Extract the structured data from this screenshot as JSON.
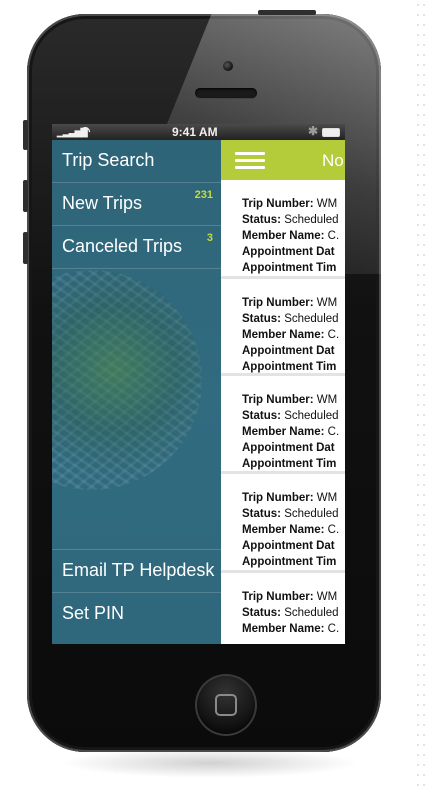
{
  "statusbar": {
    "signal": "▁▂▃▅▇",
    "wifi": "◠",
    "time": "9:41 AM",
    "bluetooth": "✱"
  },
  "sidebar": {
    "items": [
      {
        "label": "Trip Search",
        "badge": ""
      },
      {
        "label": "New Trips",
        "badge": "231"
      },
      {
        "label": "Canceled Trips",
        "badge": "3"
      }
    ],
    "bottom_items": [
      {
        "label": "Email TP Helpdesk"
      },
      {
        "label": "Set PIN"
      }
    ]
  },
  "main": {
    "title": "No",
    "trips": [
      {
        "trip_number_label": "Trip Number:",
        "trip_number": "WM",
        "status_label": "Status:",
        "status": "Scheduled",
        "member_label": "Member Name:",
        "member": "C.",
        "appt_date_label": "Appointment Dat",
        "appt_time_label": "Appointment Tim"
      },
      {
        "trip_number_label": "Trip Number:",
        "trip_number": "WM",
        "status_label": "Status:",
        "status": "Scheduled",
        "member_label": "Member Name:",
        "member": "C.",
        "appt_date_label": "Appointment Dat",
        "appt_time_label": "Appointment Tim"
      },
      {
        "trip_number_label": "Trip Number:",
        "trip_number": "WM",
        "status_label": "Status:",
        "status": "Scheduled",
        "member_label": "Member Name:",
        "member": "C.",
        "appt_date_label": "Appointment Dat",
        "appt_time_label": "Appointment Tim"
      },
      {
        "trip_number_label": "Trip Number:",
        "trip_number": "WM",
        "status_label": "Status:",
        "status": "Scheduled",
        "member_label": "Member Name:",
        "member": "C.",
        "appt_date_label": "Appointment Dat",
        "appt_time_label": "Appointment Tim"
      },
      {
        "trip_number_label": "Trip Number:",
        "trip_number": "WM",
        "status_label": "Status:",
        "status": "Scheduled",
        "member_label": "Member Name:",
        "member": "C.",
        "appt_date_label": "",
        "appt_time_label": ""
      }
    ]
  },
  "colors": {
    "sidebar_bg": "#2f6a80",
    "topbar_accent": "#b5cc3a",
    "badge": "#c8da3a"
  },
  "icons": {
    "menu": "hamburger-icon",
    "home": "home-button-icon"
  }
}
